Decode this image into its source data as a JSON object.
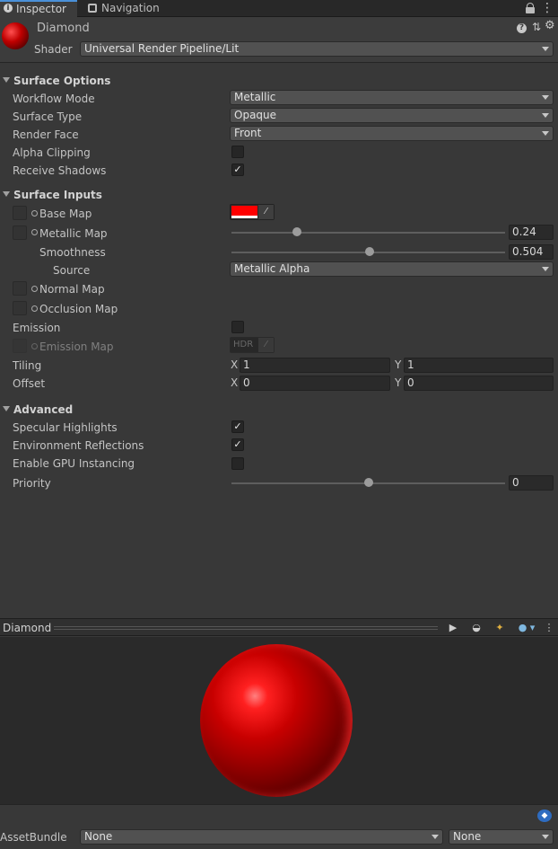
{
  "tabs": [
    {
      "label": "Inspector",
      "icon": "info-icon"
    },
    {
      "label": "Navigation",
      "icon": "navigation-icon"
    }
  ],
  "header": {
    "material_name": "Diamond",
    "shader_label": "Shader",
    "shader_value": "Universal Render Pipeline/Lit"
  },
  "surface_options": {
    "title": "Surface Options",
    "rows": [
      {
        "label": "Workflow Mode",
        "value": "Metallic"
      },
      {
        "label": "Surface Type",
        "value": "Opaque"
      },
      {
        "label": "Render Face",
        "value": "Front"
      },
      {
        "label": "Alpha Clipping",
        "checked": false
      },
      {
        "label": "Receive Shadows",
        "checked": true
      }
    ]
  },
  "surface_inputs": {
    "title": "Surface Inputs",
    "base_map": "Base Map",
    "base_color": "#ff0000",
    "metallic_map": "Metallic Map",
    "metallic_value": "0.24",
    "metallic_fraction": 0.24,
    "smoothness": "Smoothness",
    "smoothness_value": "0.504",
    "smoothness_fraction": 0.504,
    "source": "Source",
    "source_value": "Metallic Alpha",
    "normal_map": "Normal Map",
    "occlusion_map": "Occlusion Map",
    "emission": "Emission",
    "emission_checked": false,
    "emission_map": "Emission Map",
    "hdr_label": "HDR",
    "tiling": "Tiling",
    "tiling_x": "1",
    "tiling_y": "1",
    "offset": "Offset",
    "offset_x": "0",
    "offset_y": "0",
    "x_label": "X",
    "y_label": "Y"
  },
  "advanced": {
    "title": "Advanced",
    "specular": "Specular Highlights",
    "specular_checked": true,
    "env_reflections": "Environment Reflections",
    "env_checked": true,
    "gpu_instancing": "Enable GPU Instancing",
    "gpu_checked": false,
    "priority": "Priority",
    "priority_value": "0",
    "priority_fraction": 0.5
  },
  "preview": {
    "title": "Diamond",
    "sphere_color": "#e00000"
  },
  "footer": {
    "assetbundle_label": "AssetBundle",
    "bundle_value": "None",
    "variant_value": "None"
  },
  "colors": {
    "accent": "#4a90d9",
    "background": "#383838"
  }
}
